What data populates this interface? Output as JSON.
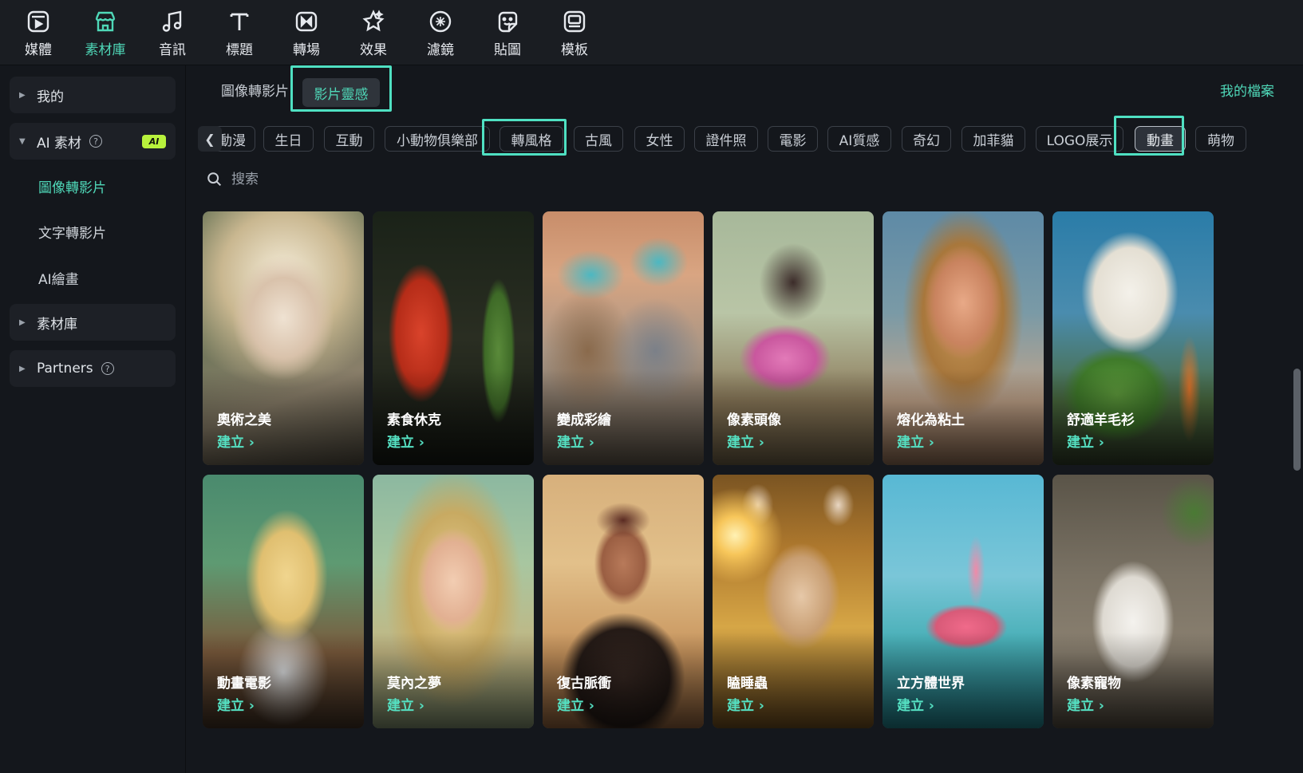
{
  "toolbar": [
    {
      "label": "媒體",
      "icon": "media-icon"
    },
    {
      "label": "素材庫",
      "icon": "store-icon",
      "active": true
    },
    {
      "label": "音訊",
      "icon": "music-note-icon"
    },
    {
      "label": "標題",
      "icon": "title-t-icon"
    },
    {
      "label": "轉場",
      "icon": "transition-icon"
    },
    {
      "label": "效果",
      "icon": "effects-star-icon"
    },
    {
      "label": "濾鏡",
      "icon": "filter-icon"
    },
    {
      "label": "貼圖",
      "icon": "sticker-icon"
    },
    {
      "label": "模板",
      "icon": "template-icon"
    }
  ],
  "sidebar": {
    "my": "我的",
    "ai_section": "AI 素材",
    "ai_badge": "AI",
    "ai_items": [
      "圖像轉影片",
      "文字轉影片",
      "AI繪畫"
    ],
    "library": "素材庫",
    "partners": "Partners"
  },
  "subtabs": {
    "image_to_video": "圖像轉影片",
    "video_inspiration": "影片靈感",
    "my_files": "我的檔案"
  },
  "categories": [
    "動漫",
    "生日",
    "互動",
    "小動物俱樂部",
    "轉風格",
    "古風",
    "女性",
    "證件照",
    "電影",
    "AI質感",
    "奇幻",
    "加菲貓",
    "LOGO展示",
    "動畫",
    "萌物"
  ],
  "selected_category": "動畫",
  "search": {
    "placeholder": "搜索"
  },
  "cards": [
    {
      "title": "奧術之美",
      "action": "建立 ›"
    },
    {
      "title": "素食休克",
      "action": "建立 ›"
    },
    {
      "title": "變成彩繪",
      "action": "建立 ›"
    },
    {
      "title": "像素頭像",
      "action": "建立 ›"
    },
    {
      "title": "熔化為粘土",
      "action": "建立 ›"
    },
    {
      "title": "舒適羊毛衫",
      "action": "建立 ›"
    },
    {
      "title": "動畫電影",
      "action": "建立 ›"
    },
    {
      "title": "莫內之夢",
      "action": "建立 ›"
    },
    {
      "title": "復古脈衝",
      "action": "建立 ›"
    },
    {
      "title": "瞌睡蟲",
      "action": "建立 ›"
    },
    {
      "title": "立方體世界",
      "action": "建立 ›"
    },
    {
      "title": "像素寵物",
      "action": "建立 ›"
    }
  ],
  "colors": {
    "accent": "#4fd8b8",
    "highlight": "#4fe0c2",
    "ai_badge": "#b8f23c"
  }
}
